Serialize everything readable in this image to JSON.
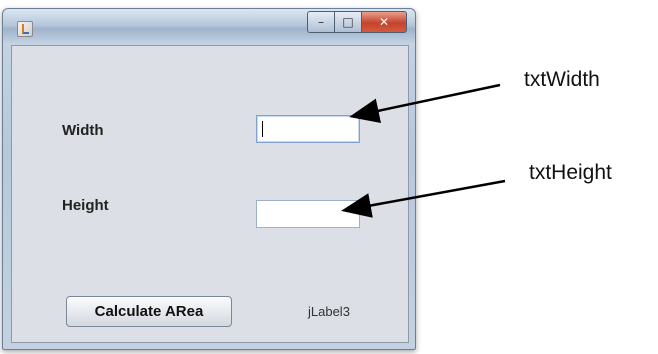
{
  "window": {
    "controls": {
      "minimize": "–",
      "maximize": "□",
      "close": "✕"
    }
  },
  "form": {
    "width_label": "Width",
    "height_label": "Height",
    "width_value": "",
    "height_value": "",
    "calculate_button": "Calculate ARea",
    "result_label": "jLabel3"
  },
  "annotations": {
    "width_callout": "txtWidth",
    "height_callout": "txtHeight"
  },
  "icons": [
    "java-app-icon",
    "minimize-icon",
    "maximize-icon",
    "close-icon",
    "arrow"
  ],
  "colors": {
    "close_button": "#c4432c",
    "content_bg": "#dcdfe5",
    "field_border": "#9bb0c9"
  }
}
